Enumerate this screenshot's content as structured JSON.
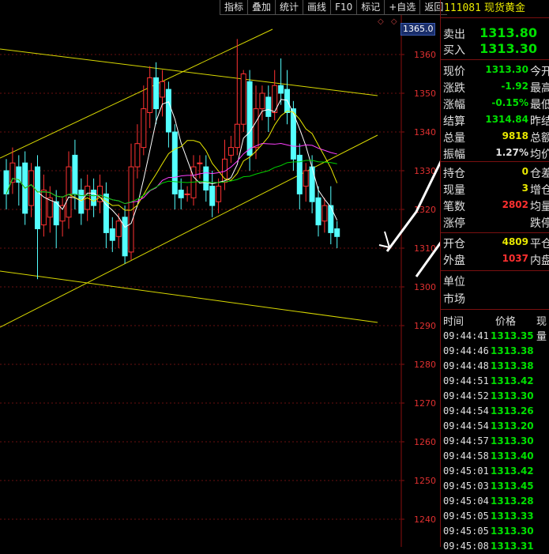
{
  "toolbar": [
    "指标",
    "叠加",
    "统计",
    "画线",
    "F10",
    "标记",
    "+自选",
    "返回"
  ],
  "price_tag": "1365.0",
  "small_icons": "◇ ◇",
  "chart_data": {
    "type": "candlestick",
    "y_ticks": [
      1360,
      1350,
      1340,
      1330,
      1320,
      1310,
      1300,
      1290,
      1280,
      1270,
      1260,
      1250,
      1240
    ],
    "ylim": [
      1233,
      1373
    ],
    "candles": [
      {
        "o": 1330,
        "c": 1324,
        "h": 1333,
        "l": 1320
      },
      {
        "o": 1327,
        "c": 1332,
        "h": 1336,
        "l": 1324
      },
      {
        "o": 1331,
        "c": 1327,
        "h": 1334,
        "l": 1321
      },
      {
        "o": 1332,
        "c": 1319,
        "h": 1335,
        "l": 1316
      },
      {
        "o": 1321,
        "c": 1330,
        "h": 1332,
        "l": 1318
      },
      {
        "o": 1331,
        "c": 1315,
        "h": 1334,
        "l": 1302
      },
      {
        "o": 1316,
        "c": 1325,
        "h": 1329,
        "l": 1313
      },
      {
        "o": 1318,
        "c": 1323,
        "h": 1326,
        "l": 1314
      },
      {
        "o": 1322,
        "c": 1316,
        "h": 1325,
        "l": 1310
      },
      {
        "o": 1317,
        "c": 1321,
        "h": 1323,
        "l": 1313
      },
      {
        "o": 1318,
        "c": 1331,
        "h": 1335,
        "l": 1315
      },
      {
        "o": 1334,
        "c": 1324,
        "h": 1338,
        "l": 1320
      },
      {
        "o": 1325,
        "c": 1319,
        "h": 1328,
        "l": 1316
      },
      {
        "o": 1320,
        "c": 1326,
        "h": 1329,
        "l": 1317
      },
      {
        "o": 1325,
        "c": 1321,
        "h": 1328,
        "l": 1318
      },
      {
        "o": 1322,
        "c": 1326,
        "h": 1329,
        "l": 1319
      },
      {
        "o": 1324,
        "c": 1314,
        "h": 1327,
        "l": 1310
      },
      {
        "o": 1315,
        "c": 1312,
        "h": 1318,
        "l": 1309
      },
      {
        "o": 1313,
        "c": 1317,
        "h": 1319,
        "l": 1310
      },
      {
        "o": 1318,
        "c": 1308,
        "h": 1321,
        "l": 1306
      },
      {
        "o": 1309,
        "c": 1331,
        "h": 1337,
        "l": 1307
      },
      {
        "o": 1331,
        "c": 1337,
        "h": 1342,
        "l": 1328
      },
      {
        "o": 1336,
        "c": 1346,
        "h": 1352,
        "l": 1334
      },
      {
        "o": 1345,
        "c": 1354,
        "h": 1357,
        "l": 1341
      },
      {
        "o": 1354,
        "c": 1346,
        "h": 1358,
        "l": 1342
      },
      {
        "o": 1349,
        "c": 1353,
        "h": 1356,
        "l": 1344
      },
      {
        "o": 1351,
        "c": 1340,
        "h": 1353,
        "l": 1336
      },
      {
        "o": 1340,
        "c": 1324,
        "h": 1342,
        "l": 1320
      },
      {
        "o": 1325,
        "c": 1323,
        "h": 1328,
        "l": 1320
      },
      {
        "o": 1324,
        "c": 1324,
        "h": 1326,
        "l": 1322
      },
      {
        "o": 1323,
        "c": 1331,
        "h": 1334,
        "l": 1321
      },
      {
        "o": 1332,
        "c": 1332,
        "h": 1334,
        "l": 1328
      },
      {
        "o": 1331,
        "c": 1325,
        "h": 1334,
        "l": 1322
      },
      {
        "o": 1326,
        "c": 1321,
        "h": 1330,
        "l": 1318
      },
      {
        "o": 1322,
        "c": 1326,
        "h": 1328,
        "l": 1319
      },
      {
        "o": 1327,
        "c": 1333,
        "h": 1338,
        "l": 1325
      },
      {
        "o": 1334,
        "c": 1336,
        "h": 1339,
        "l": 1332
      },
      {
        "o": 1336,
        "c": 1342,
        "h": 1364,
        "l": 1334
      },
      {
        "o": 1342,
        "c": 1355,
        "h": 1356,
        "l": 1340
      },
      {
        "o": 1353,
        "c": 1334,
        "h": 1356,
        "l": 1330
      },
      {
        "o": 1336,
        "c": 1346,
        "h": 1352,
        "l": 1333
      },
      {
        "o": 1346,
        "c": 1350,
        "h": 1352,
        "l": 1343
      },
      {
        "o": 1349,
        "c": 1344,
        "h": 1352,
        "l": 1340
      },
      {
        "o": 1345,
        "c": 1352,
        "h": 1356,
        "l": 1343
      },
      {
        "o": 1352,
        "c": 1350,
        "h": 1359,
        "l": 1347
      },
      {
        "o": 1351,
        "c": 1345,
        "h": 1356,
        "l": 1342
      },
      {
        "o": 1346,
        "c": 1333,
        "h": 1348,
        "l": 1330
      },
      {
        "o": 1334,
        "c": 1324,
        "h": 1337,
        "l": 1320
      },
      {
        "o": 1326,
        "c": 1330,
        "h": 1332,
        "l": 1322
      },
      {
        "o": 1331,
        "c": 1322,
        "h": 1334,
        "l": 1319
      },
      {
        "o": 1323,
        "c": 1316,
        "h": 1326,
        "l": 1313
      },
      {
        "o": 1317,
        "c": 1321,
        "h": 1323,
        "l": 1314
      },
      {
        "o": 1321,
        "c": 1314,
        "h": 1326,
        "l": 1311
      },
      {
        "o": 1315,
        "c": 1313,
        "h": 1317,
        "l": 1310
      }
    ],
    "series": [],
    "annotations": [
      "trend-channel-lines",
      "hand-drawn-arrows"
    ]
  },
  "panel": {
    "code": "111081",
    "name": "现货黄金",
    "sell_label": "卖出",
    "sell_value": "1313.80",
    "buy_label": "买入",
    "buy_value": "1313.30",
    "quote_rows": [
      {
        "label": "现价",
        "value": "1313.30",
        "color": "#00e000",
        "label2": "今开"
      },
      {
        "label": "涨跌",
        "value": "-1.92",
        "color": "#00e000",
        "label2": "最高"
      },
      {
        "label": "涨幅",
        "value": "-0.15%",
        "color": "#00e000",
        "label2": "最低"
      },
      {
        "label": "结算",
        "value": "1314.84",
        "color": "#00e000",
        "label2": "昨结"
      },
      {
        "label": "总量",
        "value": "9818",
        "color": "#e8e800",
        "label2": "总额"
      },
      {
        "label": "振幅",
        "value": "1.27%",
        "color": "#e0e0e0",
        "label2": "均价"
      }
    ],
    "quote_rows2": [
      {
        "label": "持仓",
        "value": "0",
        "color": "#e8e800",
        "label2": "仓差"
      },
      {
        "label": "现量",
        "value": "3",
        "color": "#e8e800",
        "label2": "增仓"
      },
      {
        "label": "笔数",
        "value": "2802",
        "color": "#ff3030",
        "label2": "均量"
      },
      {
        "label": "涨停",
        "value": "",
        "color": "#e0e0e0",
        "label2": "跌停"
      }
    ],
    "quote_rows3": [
      {
        "label": "开仓",
        "value": "4809",
        "color": "#e8e800",
        "label2": "平仓"
      },
      {
        "label": "外盘",
        "value": "1037",
        "color": "#ff3030",
        "label2": "内盘"
      }
    ],
    "unit_label": "单位",
    "market_label": "市场",
    "ticks_header": {
      "time": "时间",
      "price": "价格",
      "vol": "现量"
    },
    "ticks": [
      {
        "time": "09:44:41",
        "price": "1313.35"
      },
      {
        "time": "09:44:46",
        "price": "1313.38"
      },
      {
        "time": "09:44:48",
        "price": "1313.38"
      },
      {
        "time": "09:44:51",
        "price": "1313.42"
      },
      {
        "time": "09:44:52",
        "price": "1313.30"
      },
      {
        "time": "09:44:54",
        "price": "1313.26"
      },
      {
        "time": "09:44:54",
        "price": "1313.20"
      },
      {
        "time": "09:44:57",
        "price": "1313.30"
      },
      {
        "time": "09:44:58",
        "price": "1313.40"
      },
      {
        "time": "09:45:01",
        "price": "1313.42"
      },
      {
        "time": "09:45:03",
        "price": "1313.45"
      },
      {
        "time": "09:45:04",
        "price": "1313.28"
      },
      {
        "time": "09:45:05",
        "price": "1313.33"
      },
      {
        "time": "09:45:05",
        "price": "1313.30"
      },
      {
        "time": "09:45:08",
        "price": "1313.31"
      }
    ]
  }
}
